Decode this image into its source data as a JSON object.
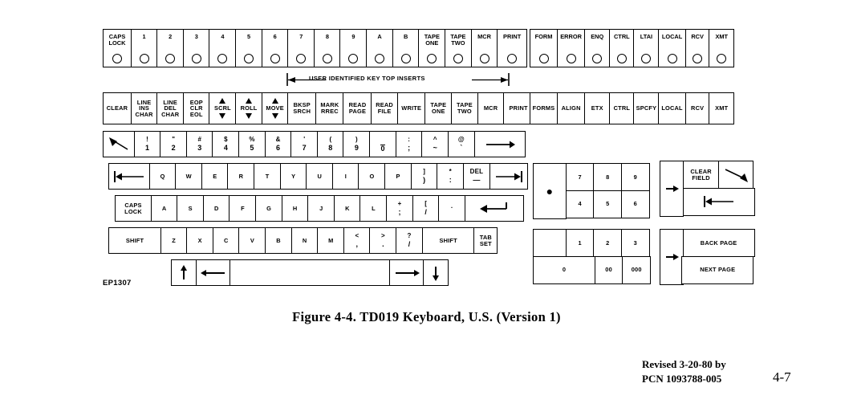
{
  "figure": {
    "caption": "Figure 4-4.  TD019  Keyboard, U.S.  (Version 1)",
    "drawing_number": "EP1307",
    "annotation": "USER IDENTIFIED KEY TOP INSERTS"
  },
  "footer": {
    "revised": "Revised 3-20-80 by",
    "pcn": "PCN 1093788-005",
    "page_number": "4-7"
  },
  "indicator_row_left": [
    {
      "label": "CAPS\nLOCK"
    },
    {
      "label": "1"
    },
    {
      "label": "2"
    },
    {
      "label": "3"
    },
    {
      "label": "4"
    },
    {
      "label": "5"
    },
    {
      "label": "6"
    },
    {
      "label": "7"
    },
    {
      "label": "8"
    },
    {
      "label": "9"
    },
    {
      "label": "A"
    },
    {
      "label": "B"
    },
    {
      "label": "TAPE\nONE"
    },
    {
      "label": "TAPE\nTWO"
    },
    {
      "label": "MCR"
    },
    {
      "label": "PRINT"
    }
  ],
  "indicator_row_right": [
    {
      "label": "FORM"
    },
    {
      "label": "ERROR"
    },
    {
      "label": "ENQ"
    },
    {
      "label": "CTRL"
    },
    {
      "label": "LTAI"
    },
    {
      "label": "LOCAL"
    },
    {
      "label": "RCV"
    },
    {
      "label": "XMT"
    }
  ],
  "function_row_left": [
    {
      "label": "CLEAR"
    },
    {
      "label": "LINE\nINS\nCHAR"
    },
    {
      "label": "LINE\nDEL\nCHAR"
    },
    {
      "label": "EOP\nCLR\nEOL"
    },
    {
      "label": "SCRL",
      "arrows": "up-down"
    },
    {
      "label": "ROLL",
      "arrows": "up-down"
    },
    {
      "label": "MOVE",
      "arrows": "up-down"
    },
    {
      "label": "BKSP\nSRCH"
    },
    {
      "label": "MARK\nRREC"
    },
    {
      "label": "READ\nPAGE"
    },
    {
      "label": "READ\nFILE"
    },
    {
      "label": "WRITE"
    },
    {
      "label": "TAPE\nONE"
    },
    {
      "label": "TAPE\nTWO"
    },
    {
      "label": "MCR"
    },
    {
      "label": "PRINT"
    }
  ],
  "function_row_right": [
    {
      "label": "FORMS"
    },
    {
      "label": "ALIGN"
    },
    {
      "label": "ETX"
    },
    {
      "label": "CTRL"
    },
    {
      "label": "SPCFY"
    },
    {
      "label": "LOCAL"
    },
    {
      "label": "RCV"
    },
    {
      "label": "XMT"
    }
  ],
  "number_row": [
    {
      "icon": "diagonal-arrow-up-left"
    },
    {
      "upper": "!",
      "lower": "1"
    },
    {
      "upper": "\"",
      "lower": "2"
    },
    {
      "upper": "#",
      "lower": "3"
    },
    {
      "upper": "$",
      "lower": "4"
    },
    {
      "upper": "%",
      "lower": "5"
    },
    {
      "upper": "&",
      "lower": "6"
    },
    {
      "upper": "'",
      "lower": "7"
    },
    {
      "upper": "(",
      "lower": "8"
    },
    {
      "upper": ")",
      "lower": "9"
    },
    {
      "upper": "",
      "lower": "0",
      "overline": true
    },
    {
      "upper": ":",
      "lower": ";"
    },
    {
      "upper": "^",
      "lower": "~"
    },
    {
      "upper": "@",
      "lower": "`"
    },
    {
      "icon": "arrow-right-long"
    }
  ],
  "qwerty_row": [
    {
      "icon": "tab-left"
    },
    {
      "label": "Q"
    },
    {
      "label": "W"
    },
    {
      "label": "E"
    },
    {
      "label": "R"
    },
    {
      "label": "T"
    },
    {
      "label": "Y"
    },
    {
      "label": "U"
    },
    {
      "label": "I"
    },
    {
      "label": "O"
    },
    {
      "label": "P"
    },
    {
      "upper": "]",
      "lower": ")"
    },
    {
      "upper": "*",
      "lower": ":"
    },
    {
      "upper": "DEL",
      "lower": "—"
    },
    {
      "icon": "tab-right"
    }
  ],
  "home_row": [
    {
      "label": "CAPS\nLOCK"
    },
    {
      "label": "A"
    },
    {
      "label": "S"
    },
    {
      "label": "D"
    },
    {
      "label": "F"
    },
    {
      "label": "G"
    },
    {
      "label": "H"
    },
    {
      "label": "J"
    },
    {
      "label": "K"
    },
    {
      "label": "L"
    },
    {
      "upper": "+",
      "lower": ";"
    },
    {
      "upper": "[",
      "lower": "/"
    },
    {
      "upper": "·",
      "lower": ""
    },
    {
      "icon": "return-arrow"
    }
  ],
  "shift_row": [
    {
      "label": "SHIFT"
    },
    {
      "label": "Z"
    },
    {
      "label": "X"
    },
    {
      "label": "C"
    },
    {
      "label": "V"
    },
    {
      "label": "B"
    },
    {
      "label": "N"
    },
    {
      "label": "M"
    },
    {
      "upper": "<",
      "lower": ","
    },
    {
      "upper": ">",
      "lower": "."
    },
    {
      "upper": "?",
      "lower": "/"
    },
    {
      "label": "SHIFT"
    },
    {
      "label": "TAB\nSET"
    }
  ],
  "space_row": [
    {
      "icon": "arrow-up"
    },
    {
      "icon": "arrow-left"
    },
    {
      "icon": "space-bar"
    },
    {
      "icon": "arrow-right"
    },
    {
      "icon": "arrow-down"
    }
  ],
  "keypad": {
    "dot_key": "●",
    "upper_rows": [
      [
        "7",
        "8",
        "9"
      ],
      [
        "4",
        "5",
        "6"
      ]
    ],
    "lower_rows": [
      [
        "1",
        "2",
        "3"
      ]
    ],
    "zero_row": [
      "0",
      "00",
      "000"
    ]
  },
  "right_block": {
    "tab_key_icon": "arrow-right",
    "clear_field": "CLEAR\nFIELD",
    "clear_field_icon": "diagonal-arrow-down-right",
    "field_back_icon": "tab-left",
    "back_page": "BACK PAGE",
    "next_page": "NEXT PAGE",
    "page_tab_icon": "arrow-right"
  },
  "colors": {
    "ink": "#000000",
    "paper": "#ffffff"
  }
}
